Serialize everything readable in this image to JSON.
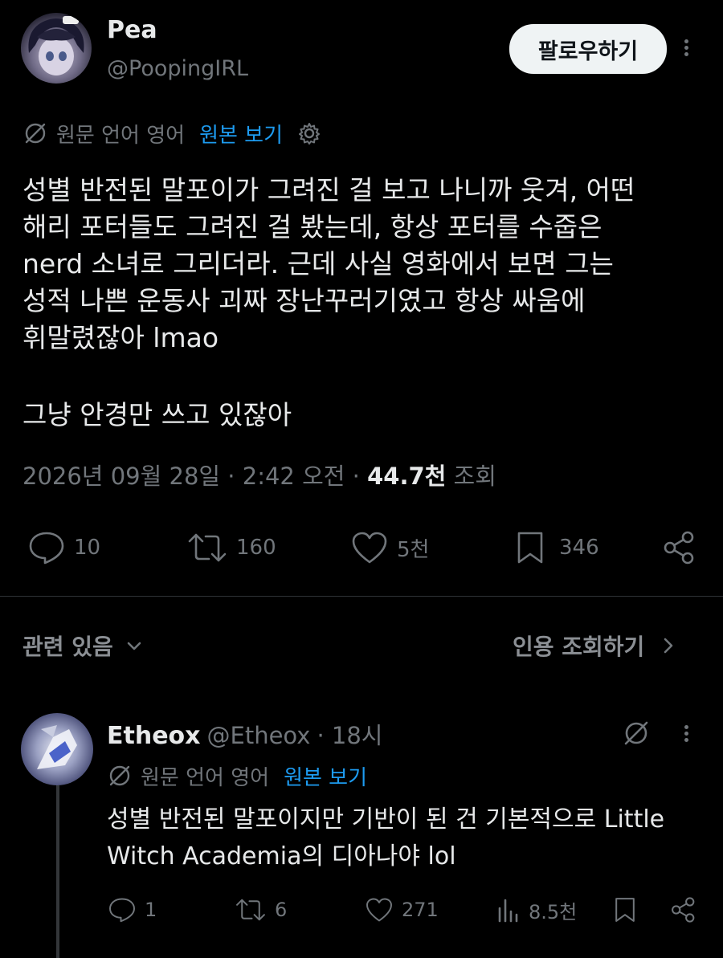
{
  "main_tweet": {
    "author_name": "Pea",
    "author_handle": "@PoopingIRL",
    "follow_label": "팔로우하기",
    "translation_note": "원문 언어 영어",
    "show_original_label": "원본 보기",
    "body_p1": "성별 반전된 말포이가 그려진 걸 보고 나니까 웃겨, 어떤\n해리 포터들도 그려진 걸 봤는데, 항상 포터를 수줍은\nnerd 소녀로 그리더라. 근데 사실 영화에서 보면 그는\n성적 나쁜 운동사 괴짜 장난꾸러기였고 항상 싸움에\n휘말렸잖아 lmao",
    "body_p2": "그냥 안경만 쓰고 있잖아",
    "timestamp": "2026년 09월 28일 · 2:42 오전 ·",
    "views_count": "44.7천",
    "views_label": "조회",
    "replies": "10",
    "retweets": "160",
    "likes": "5천",
    "bookmarks": "346"
  },
  "related_bar": {
    "related_label": "관련 있음",
    "quotes_label": "인용 조회하기"
  },
  "reply_tweet": {
    "author_name": "Etheox",
    "author_handle": "@Etheox",
    "time": "· 18시",
    "translation_note": "원문 언어 영어",
    "show_original_label": "원본 보기",
    "body": "성별 반전된 말포이지만 기반이 된 건 기본적으로 Little\nWitch Academia의 디아나야 lol",
    "replies": "1",
    "retweets": "6",
    "likes": "271",
    "views": "8.5천"
  },
  "colors": {
    "background": "#000000",
    "text": "#e7e9ea",
    "muted": "#71767b",
    "link": "#1d9bf0"
  }
}
